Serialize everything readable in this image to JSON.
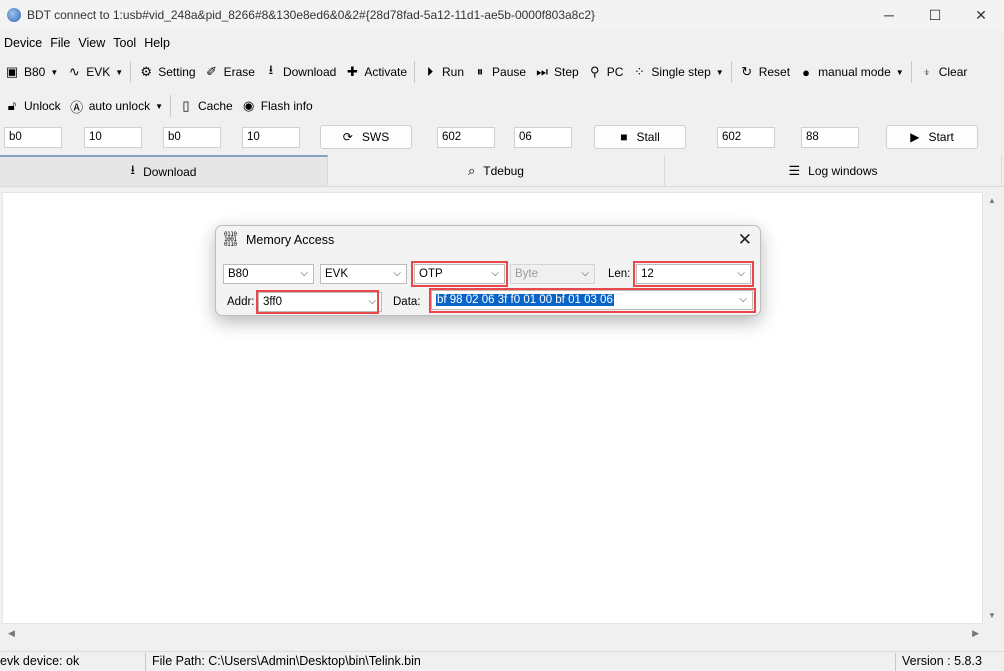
{
  "window": {
    "title": "BDT connect to 1:usb#vid_248a&pid_8266#8&130e8ed6&0&2#{28d78fad-5a12-11d1-ae5b-0000f803a8c2}",
    "minimize_icon": "─",
    "maximize_icon": "☐",
    "close_icon": "✕"
  },
  "menu": [
    "Device",
    "File",
    "View",
    "Tool",
    "Help"
  ],
  "toolbar1": {
    "chip": "B80",
    "board": "EVK",
    "setting": "Setting",
    "erase": "Erase",
    "download": "Download",
    "activate": "Activate",
    "run": "Run",
    "pause": "Pause",
    "step": "Step",
    "pc": "PC",
    "single_step": "Single step",
    "reset": "Reset",
    "manual_mode": "manual mode",
    "clear": "Clear"
  },
  "toolbar2": {
    "unlock": "Unlock",
    "auto_unlock": "auto unlock",
    "cache": "Cache",
    "flash_info": "Flash info"
  },
  "inputs": {
    "f1": "b0",
    "f2": "10",
    "f3": "b0",
    "f4": "10",
    "sws": "SWS",
    "f5": "602",
    "f6": "06",
    "stall": "Stall",
    "f7": "602",
    "f8": "88",
    "start": "Start"
  },
  "tabs": {
    "download": "Download",
    "tdebug": "Tdebug",
    "log": "Log windows"
  },
  "dialog": {
    "title": "Memory Access",
    "chip": "B80",
    "board": "EVK",
    "memory": "OTP",
    "unit": "Byte",
    "len_label": "Len:",
    "len": "12",
    "addr_label": "Addr:",
    "addr": "3ff0",
    "data_label": "Data:",
    "data": "bf 98 02 06 3f f0 01 00 bf 01 03 06"
  },
  "status": {
    "device": "evk device: ok",
    "file_path": "File Path:  C:\\Users\\Admin\\Desktop\\bin\\Telink.bin",
    "version": "Version : 5.8.3"
  },
  "colors": {
    "highlight": "#e8474c",
    "selection": "#0a64c8"
  }
}
